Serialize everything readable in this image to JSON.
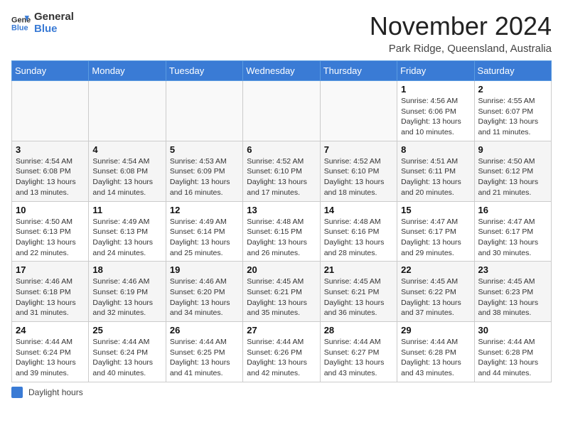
{
  "logo": {
    "general": "General",
    "blue": "Blue"
  },
  "title": "November 2024",
  "location": "Park Ridge, Queensland, Australia",
  "legend": {
    "label": "Daylight hours"
  },
  "days_of_week": [
    "Sunday",
    "Monday",
    "Tuesday",
    "Wednesday",
    "Thursday",
    "Friday",
    "Saturday"
  ],
  "weeks": [
    [
      {
        "day": "",
        "detail": ""
      },
      {
        "day": "",
        "detail": ""
      },
      {
        "day": "",
        "detail": ""
      },
      {
        "day": "",
        "detail": ""
      },
      {
        "day": "",
        "detail": ""
      },
      {
        "day": "1",
        "detail": "Sunrise: 4:56 AM\nSunset: 6:06 PM\nDaylight: 13 hours\nand 10 minutes."
      },
      {
        "day": "2",
        "detail": "Sunrise: 4:55 AM\nSunset: 6:07 PM\nDaylight: 13 hours\nand 11 minutes."
      }
    ],
    [
      {
        "day": "3",
        "detail": "Sunrise: 4:54 AM\nSunset: 6:08 PM\nDaylight: 13 hours\nand 13 minutes."
      },
      {
        "day": "4",
        "detail": "Sunrise: 4:54 AM\nSunset: 6:08 PM\nDaylight: 13 hours\nand 14 minutes."
      },
      {
        "day": "5",
        "detail": "Sunrise: 4:53 AM\nSunset: 6:09 PM\nDaylight: 13 hours\nand 16 minutes."
      },
      {
        "day": "6",
        "detail": "Sunrise: 4:52 AM\nSunset: 6:10 PM\nDaylight: 13 hours\nand 17 minutes."
      },
      {
        "day": "7",
        "detail": "Sunrise: 4:52 AM\nSunset: 6:10 PM\nDaylight: 13 hours\nand 18 minutes."
      },
      {
        "day": "8",
        "detail": "Sunrise: 4:51 AM\nSunset: 6:11 PM\nDaylight: 13 hours\nand 20 minutes."
      },
      {
        "day": "9",
        "detail": "Sunrise: 4:50 AM\nSunset: 6:12 PM\nDaylight: 13 hours\nand 21 minutes."
      }
    ],
    [
      {
        "day": "10",
        "detail": "Sunrise: 4:50 AM\nSunset: 6:13 PM\nDaylight: 13 hours\nand 22 minutes."
      },
      {
        "day": "11",
        "detail": "Sunrise: 4:49 AM\nSunset: 6:13 PM\nDaylight: 13 hours\nand 24 minutes."
      },
      {
        "day": "12",
        "detail": "Sunrise: 4:49 AM\nSunset: 6:14 PM\nDaylight: 13 hours\nand 25 minutes."
      },
      {
        "day": "13",
        "detail": "Sunrise: 4:48 AM\nSunset: 6:15 PM\nDaylight: 13 hours\nand 26 minutes."
      },
      {
        "day": "14",
        "detail": "Sunrise: 4:48 AM\nSunset: 6:16 PM\nDaylight: 13 hours\nand 28 minutes."
      },
      {
        "day": "15",
        "detail": "Sunrise: 4:47 AM\nSunset: 6:17 PM\nDaylight: 13 hours\nand 29 minutes."
      },
      {
        "day": "16",
        "detail": "Sunrise: 4:47 AM\nSunset: 6:17 PM\nDaylight: 13 hours\nand 30 minutes."
      }
    ],
    [
      {
        "day": "17",
        "detail": "Sunrise: 4:46 AM\nSunset: 6:18 PM\nDaylight: 13 hours\nand 31 minutes."
      },
      {
        "day": "18",
        "detail": "Sunrise: 4:46 AM\nSunset: 6:19 PM\nDaylight: 13 hours\nand 32 minutes."
      },
      {
        "day": "19",
        "detail": "Sunrise: 4:46 AM\nSunset: 6:20 PM\nDaylight: 13 hours\nand 34 minutes."
      },
      {
        "day": "20",
        "detail": "Sunrise: 4:45 AM\nSunset: 6:21 PM\nDaylight: 13 hours\nand 35 minutes."
      },
      {
        "day": "21",
        "detail": "Sunrise: 4:45 AM\nSunset: 6:21 PM\nDaylight: 13 hours\nand 36 minutes."
      },
      {
        "day": "22",
        "detail": "Sunrise: 4:45 AM\nSunset: 6:22 PM\nDaylight: 13 hours\nand 37 minutes."
      },
      {
        "day": "23",
        "detail": "Sunrise: 4:45 AM\nSunset: 6:23 PM\nDaylight: 13 hours\nand 38 minutes."
      }
    ],
    [
      {
        "day": "24",
        "detail": "Sunrise: 4:44 AM\nSunset: 6:24 PM\nDaylight: 13 hours\nand 39 minutes."
      },
      {
        "day": "25",
        "detail": "Sunrise: 4:44 AM\nSunset: 6:24 PM\nDaylight: 13 hours\nand 40 minutes."
      },
      {
        "day": "26",
        "detail": "Sunrise: 4:44 AM\nSunset: 6:25 PM\nDaylight: 13 hours\nand 41 minutes."
      },
      {
        "day": "27",
        "detail": "Sunrise: 4:44 AM\nSunset: 6:26 PM\nDaylight: 13 hours\nand 42 minutes."
      },
      {
        "day": "28",
        "detail": "Sunrise: 4:44 AM\nSunset: 6:27 PM\nDaylight: 13 hours\nand 43 minutes."
      },
      {
        "day": "29",
        "detail": "Sunrise: 4:44 AM\nSunset: 6:28 PM\nDaylight: 13 hours\nand 43 minutes."
      },
      {
        "day": "30",
        "detail": "Sunrise: 4:44 AM\nSunset: 6:28 PM\nDaylight: 13 hours\nand 44 minutes."
      }
    ]
  ]
}
